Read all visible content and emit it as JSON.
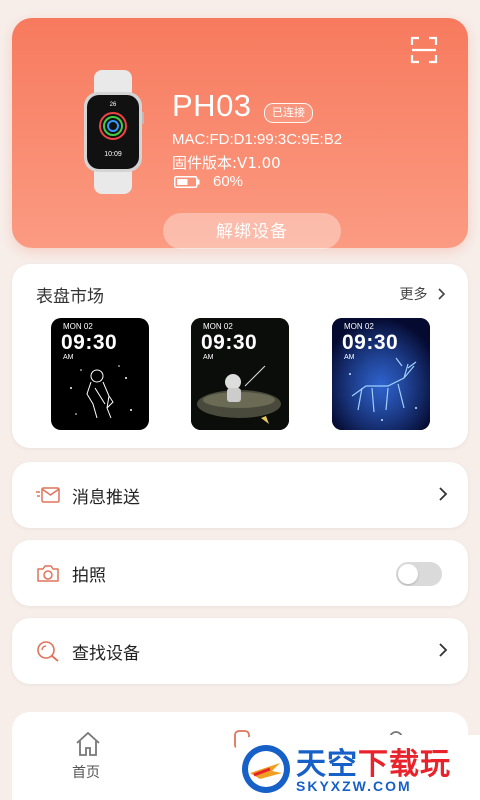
{
  "device": {
    "name": "PH03",
    "status_badge": "已连接",
    "mac": "MAC:FD:D1:99:3C:9E:B2",
    "firmware": "固件版本:V1.00",
    "battery": "60%",
    "battery_level": 0.6,
    "unbind_label": "解绑设备",
    "watch_face": {
      "date": "26",
      "time": "10:09"
    }
  },
  "market": {
    "title": "表盘市场",
    "more_label": "更多",
    "faces": [
      {
        "date": "MON  02",
        "time": "09:30",
        "ampm": "AM",
        "theme": "astronaut-outline"
      },
      {
        "date": "MON  02",
        "time": "09:30",
        "ampm": "AM",
        "theme": "astronaut-boat"
      },
      {
        "date": "MON  02",
        "time": "09:30",
        "ampm": "AM",
        "theme": "blue-deer"
      }
    ]
  },
  "menu": {
    "message_push": "消息推送",
    "photo": "拍照",
    "photo_toggle_on": false,
    "find_device": "查找设备"
  },
  "nav": {
    "home_label": "首页"
  },
  "watermark": {
    "title_a": "天空",
    "title_b": "下载玩",
    "domain": "SKYXZW.COM"
  },
  "colors": {
    "accent": "#f77a5e",
    "icon": "#e0735a"
  }
}
